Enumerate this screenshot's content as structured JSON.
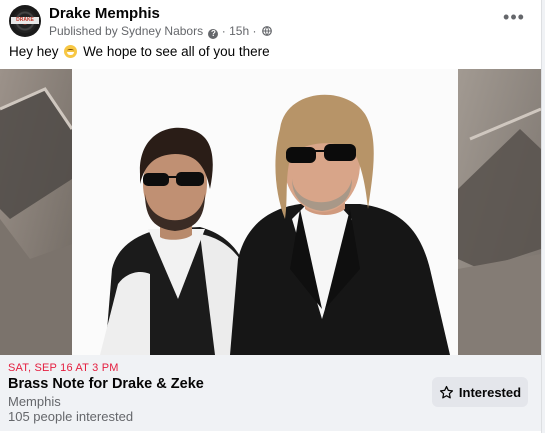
{
  "post": {
    "page_name": "Drake Memphis",
    "published_by": "Published by Sydney Nabors",
    "time_ago": "15h",
    "meta_separator": "·",
    "text_before_emoji": "Hey hey",
    "text_after_emoji": "We hope to see all of you there",
    "emoji": "grinning-face-emoji",
    "more_icon": "more-horizontal-icon",
    "avatar_logo_text": "DRAKE"
  },
  "event": {
    "date": "SAT, SEP 16 AT 3 PM",
    "title": "Brass Note for Drake & Zeke",
    "location": "Memphis",
    "interested_count": "105 people interested",
    "interested_button_label": "Interested",
    "interested_icon": "star-outline-icon",
    "date_color": "#e41e3f"
  },
  "colors": {
    "secondary_text": "#65676b",
    "button_bg": "#e4e6eb",
    "details_bg": "#f0f2f5"
  }
}
